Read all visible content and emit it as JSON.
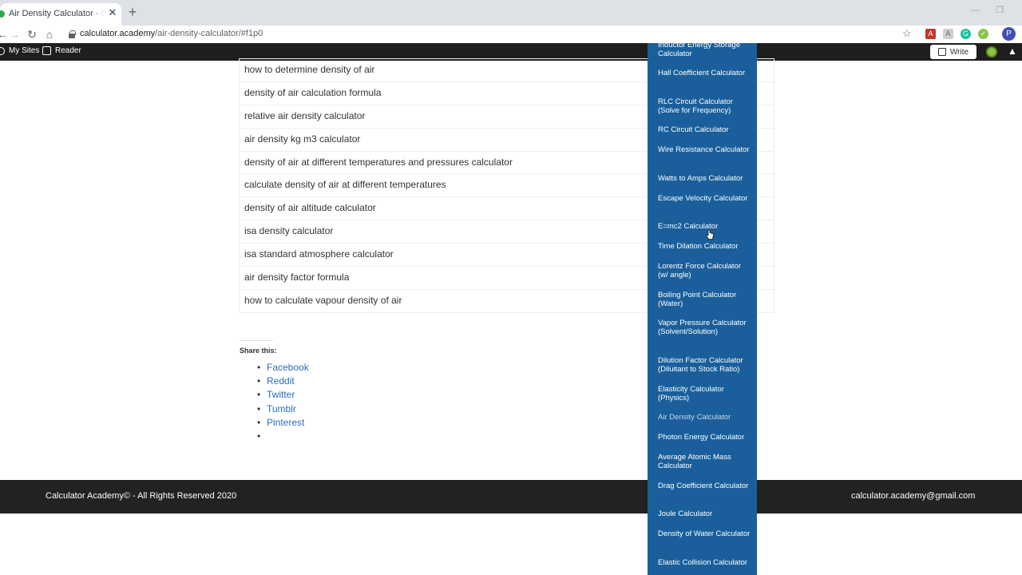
{
  "browser": {
    "tab_title": "Air Density Calculator - Calculator Academy",
    "tab_close": "✕",
    "new_tab": "+",
    "url_host": "calculator.academy",
    "url_path": "/air-density-calculator/#f1p0",
    "profile_initial": "P",
    "window_controls": [
      "—",
      "❐"
    ]
  },
  "wp_toolbar": {
    "my_sites": "My Sites",
    "reader": "Reader",
    "write": "Write"
  },
  "results": [
    "how to determine density of air",
    "density of air calculation formula",
    "relative air density calculator",
    "air density kg m3 calculator",
    "density of air at different temperatures and pressures calculator",
    "calculate density of air at different temperatures",
    "density of air altitude calculator",
    "isa density calculator",
    "isa standard atmosphere calculator",
    "air density factor formula",
    "how to calculate vapour density of air"
  ],
  "share": {
    "title": "Share this:",
    "links": [
      "Facebook",
      "Reddit",
      "Twitter",
      "Tumblr",
      "Pinterest",
      ""
    ]
  },
  "footer": {
    "copyright": "Calculator Academy© - All Rights Reserved 2020",
    "email": "calculator.academy@gmail.com"
  },
  "dropdown": {
    "active_item": "Air Density Calculator",
    "items": [
      "Inductor Energy Storage Calculator",
      "Hall Coefficient Calculator",
      "RLC Circuit Calculator (Solve for Frequency)",
      "RC Circuit Calculator",
      "Wire Resistance Calculator",
      "Watts to Amps Calculator",
      "Escape Velocity Calculator",
      "E=mc2 Calculator",
      "Time Dilation Calculator",
      "Lorentz Force Calculator (w/ angle)",
      "Boiling Point Calculator (Water)",
      "Vapor Pressure Calculator (Solvent/Solution)",
      "Dilution Factor Calculator (Diluitant to Stock Ratio)",
      "Elasticity Calculator (Physics)",
      "Air Density Calculator",
      "Photon Energy Calculator",
      "Average Atomic Mass Calculator",
      "Drag Coefficient Calculator",
      "Joule Calculator",
      "Density of Water Calculator",
      "Elastic Collision Calculator"
    ]
  },
  "colors": {
    "dropdown_bg": "#1a5f9b",
    "footer_bg": "#222222",
    "link": "#2a6ebb",
    "wp_bar": "#1e1e1e"
  }
}
